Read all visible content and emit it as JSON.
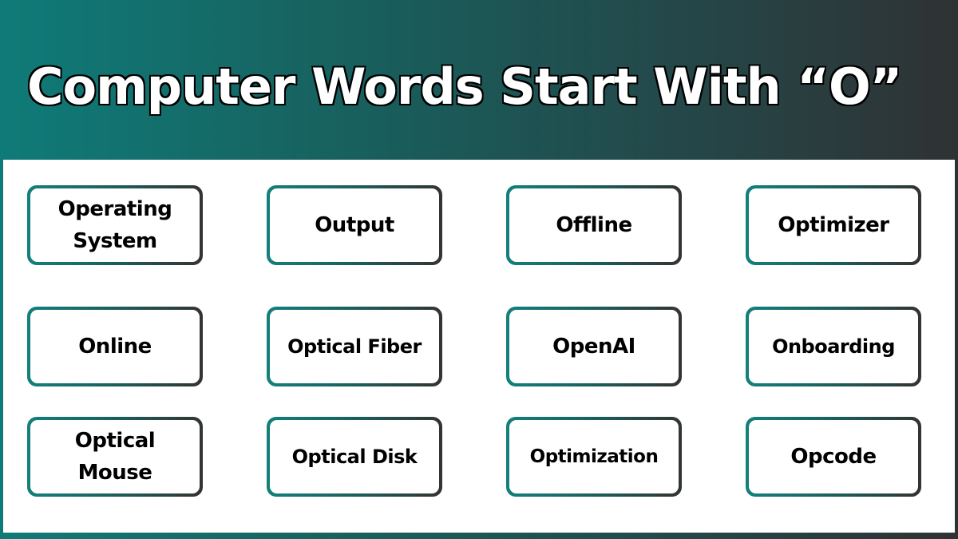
{
  "header": {
    "title": "Computer Words Start With “O”"
  },
  "colors": {
    "gradient_start": "#0f7b78",
    "gradient_end": "#2f3233",
    "panel_bg": "#ffffff",
    "text": "#000000"
  },
  "words": [
    {
      "label": "Operating System"
    },
    {
      "label": "Output"
    },
    {
      "label": "Offline"
    },
    {
      "label": "Optimizer"
    },
    {
      "label": "Online"
    },
    {
      "label": "Optical Fiber"
    },
    {
      "label": "OpenAI"
    },
    {
      "label": "Onboarding"
    },
    {
      "label": "Optical Mouse"
    },
    {
      "label": "Optical Disk"
    },
    {
      "label": "Optimization"
    },
    {
      "label": "Opcode"
    }
  ]
}
